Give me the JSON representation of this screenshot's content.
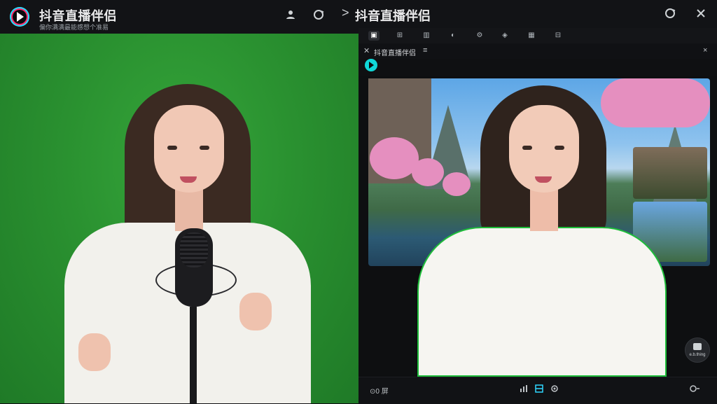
{
  "left_header": {
    "title": "抖音直播伴侣",
    "subtitle": "偏你满满最能感想个准易"
  },
  "left_icons": {
    "profile": "person-icon",
    "refresh": "refresh-icon"
  },
  "right_header": {
    "chevron": ">",
    "title": "抖音直播伴侣",
    "icons": [
      "refresh-icon",
      "close-icon"
    ]
  },
  "toolbar": {
    "items": [
      "▣",
      "⊞",
      "▥",
      "◐",
      "⚙",
      "◈",
      "▦",
      "⊟"
    ],
    "active_index": 0
  },
  "window_bar": {
    "title": "抖音直播伴侣",
    "menu_glyph": "≡",
    "close_glyph": "×"
  },
  "bottom_bar": {
    "left_label": "⊙0 屏",
    "icons": [
      "bars-icon",
      "layout-icon",
      "settings-icon"
    ],
    "right_icon": "sync-icon"
  },
  "float_button": {
    "label": "e.b.thing"
  },
  "colors": {
    "green_screen": "#2a9130",
    "accent_cyan": "#1de0ff",
    "accent_pink": "#ff2a6a",
    "outline_green": "#1ebd3a"
  }
}
